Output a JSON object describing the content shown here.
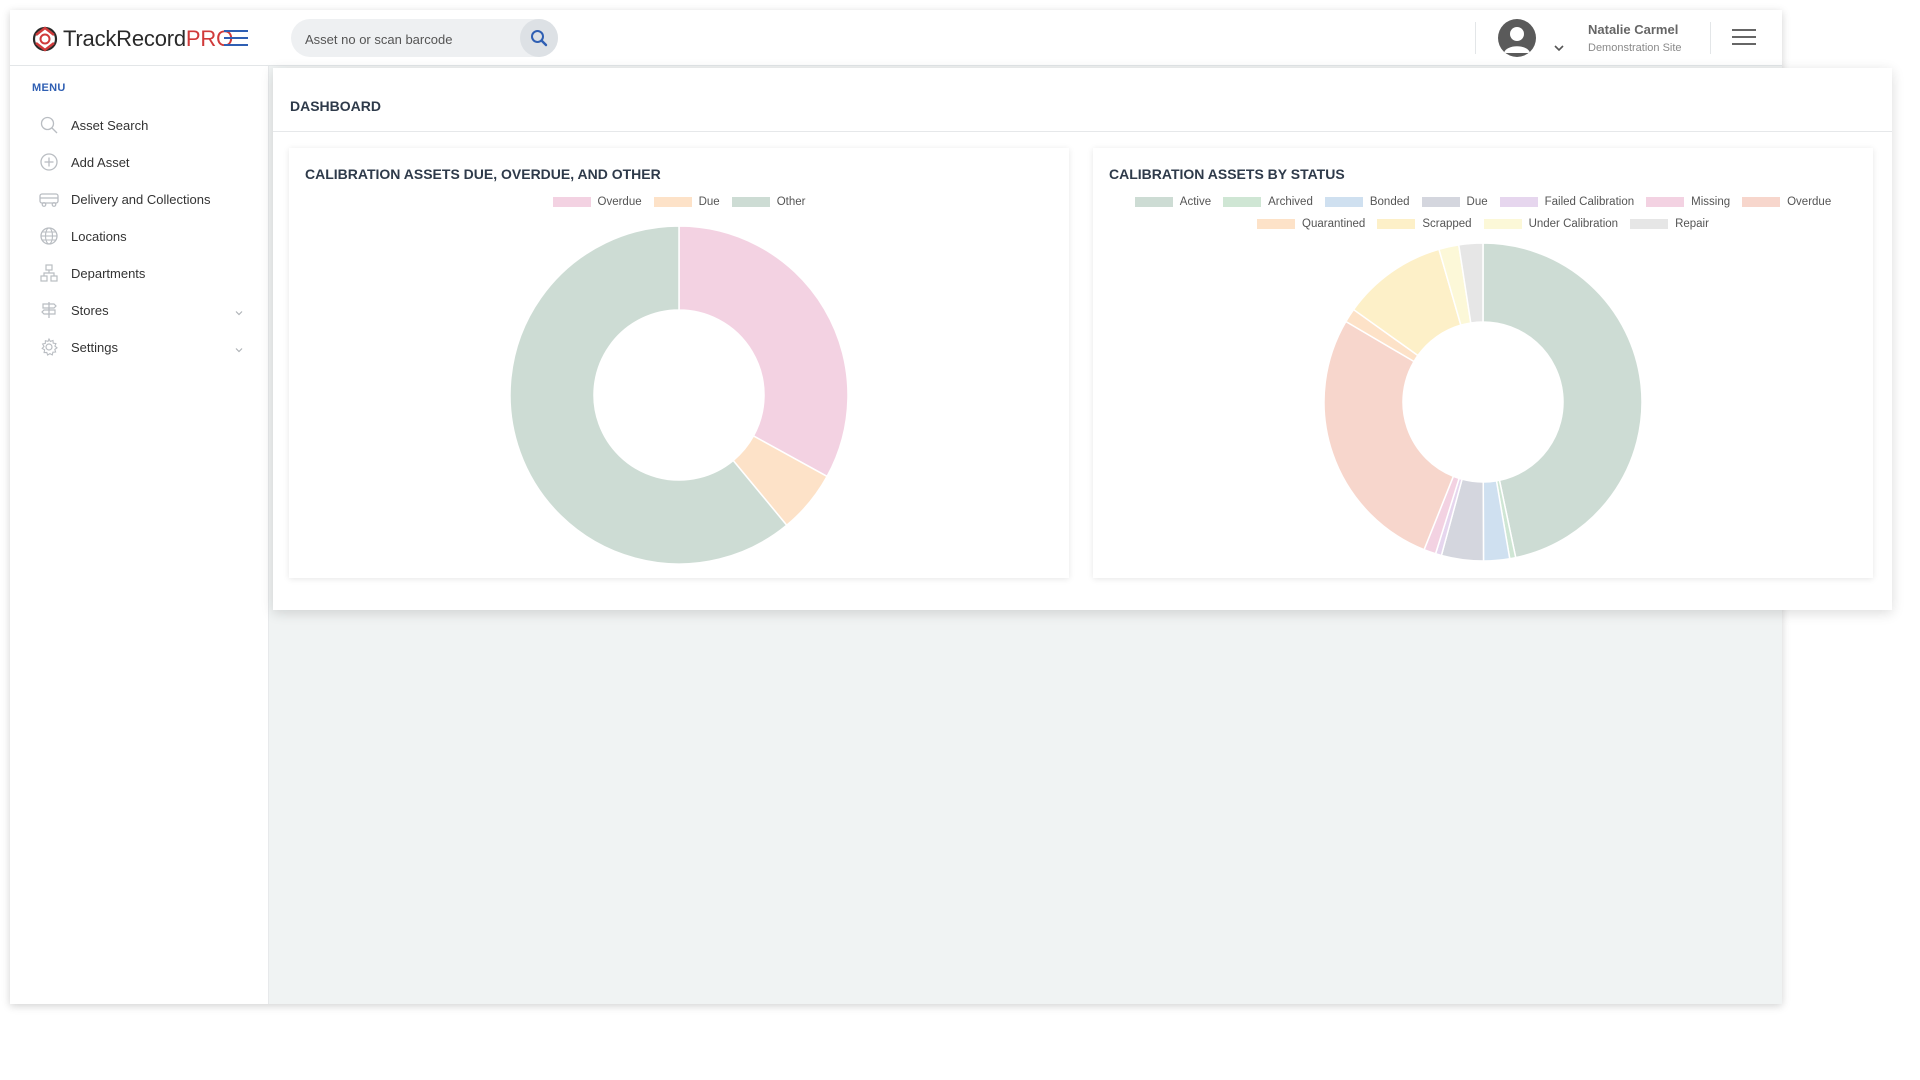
{
  "header": {
    "logo_main": "TrackRecord",
    "logo_suffix": "PRO",
    "search_placeholder": "Asset no or scan barcode",
    "user_name": "Natalie Carmel",
    "user_site": "Demonstration Site"
  },
  "sidebar": {
    "title": "MENU",
    "items": [
      {
        "label": "Asset Search",
        "icon": "search-icon"
      },
      {
        "label": "Add Asset",
        "icon": "plus-circle-icon"
      },
      {
        "label": "Delivery and Collections",
        "icon": "truck-icon"
      },
      {
        "label": "Locations",
        "icon": "globe-icon"
      },
      {
        "label": "Departments",
        "icon": "org-chart-icon"
      },
      {
        "label": "Stores",
        "icon": "signpost-icon",
        "has_submenu": true
      },
      {
        "label": "Settings",
        "icon": "gear-icon",
        "has_submenu": true
      }
    ]
  },
  "dashboard": {
    "title": "DASHBOARD"
  },
  "colors": {
    "brand_blue": "#2f5fb3",
    "brand_red": "#d03a3a"
  },
  "chart_data": [
    {
      "type": "pie",
      "variant": "doughnut",
      "title": "CALIBRATION ASSETS DUE, OVERDUE, AND OTHER",
      "legend_position": "top",
      "series": [
        {
          "name": "Overdue",
          "value": 33,
          "color": "#f3d2e2"
        },
        {
          "name": "Due",
          "value": 6,
          "color": "#fde2c8"
        },
        {
          "name": "Other",
          "value": 61,
          "color": "#cddcd4"
        }
      ]
    },
    {
      "type": "pie",
      "variant": "doughnut",
      "title": "CALIBRATION ASSETS BY STATUS",
      "legend_position": "top",
      "series": [
        {
          "name": "Active",
          "value": 46,
          "color": "#cddcd4"
        },
        {
          "name": "Archived",
          "value": 0.6,
          "color": "#cfe6d4"
        },
        {
          "name": "Bonded",
          "value": 2.6,
          "color": "#cfe0f0"
        },
        {
          "name": "Due",
          "value": 4.2,
          "color": "#d4d6de"
        },
        {
          "name": "Failed Calibration",
          "value": 0.6,
          "color": "#e6d6ee"
        },
        {
          "name": "Missing",
          "value": 1.2,
          "color": "#f3d2e2"
        },
        {
          "name": "Overdue",
          "value": 27,
          "color": "#f7d6cc"
        },
        {
          "name": "Quarantined",
          "value": 1.4,
          "color": "#fde2c8"
        },
        {
          "name": "Scrapped",
          "value": 10.5,
          "color": "#fdf0c8"
        },
        {
          "name": "Under Calibration",
          "value": 2.0,
          "color": "#fcf8d8"
        },
        {
          "name": "Repair",
          "value": 2.4,
          "color": "#e6e6e6"
        }
      ]
    }
  ]
}
